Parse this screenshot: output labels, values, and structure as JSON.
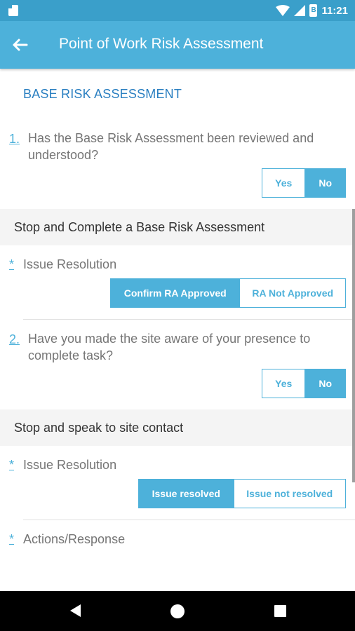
{
  "status_bar": {
    "time": "11:21",
    "battery_text": "B"
  },
  "app_bar": {
    "title": "Point of Work Risk Assessment"
  },
  "section": {
    "title": "BASE RISK ASSESSMENT"
  },
  "questions": [
    {
      "number": "1.",
      "text": "Has the Base Risk Assessment been reviewed and understood?",
      "yes_label": "Yes",
      "no_label": "No",
      "selected": "No"
    },
    {
      "number": "2.",
      "text": "Have you made the site aware of your presence to complete task?",
      "yes_label": "Yes",
      "no_label": "No",
      "selected": "No"
    }
  ],
  "bands": [
    {
      "text": "Stop and Complete a Base Risk Assessment"
    },
    {
      "text": "Stop and speak to site contact"
    }
  ],
  "resolutions": [
    {
      "marker": "*",
      "label": "Issue Resolution",
      "option_a": "Confirm RA Approved",
      "option_b": "RA Not Approved",
      "selected": "Confirm RA Approved"
    },
    {
      "marker": "*",
      "label": "Issue Resolution",
      "option_a": "Issue resolved",
      "option_b": "Issue not resolved",
      "selected": "Issue resolved"
    }
  ],
  "actions": {
    "marker": "*",
    "label": "Actions/Response"
  },
  "colors": {
    "status_bar": "#3a9fca",
    "app_bar": "#4db1da",
    "accent": "#4db1da",
    "section_title": "#2a7fc1"
  }
}
